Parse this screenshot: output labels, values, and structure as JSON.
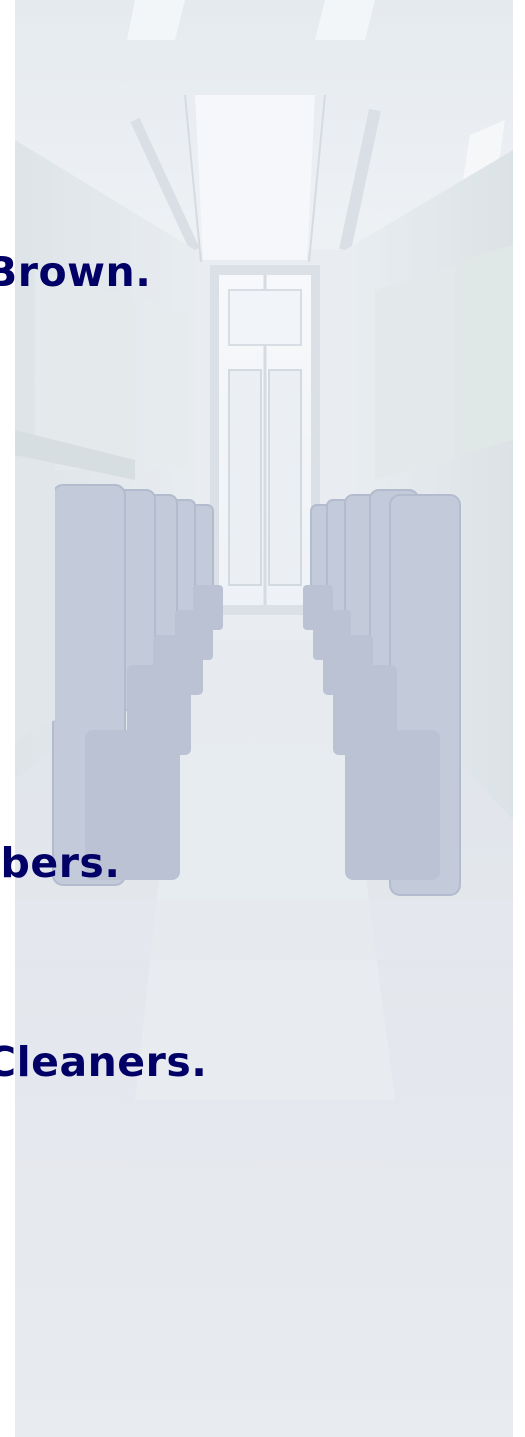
{
  "slide": {
    "lines": [
      "Brown.",
      "ibers.",
      "Cleaners."
    ],
    "text_color": "#000066"
  },
  "background": {
    "icon": "salon-interior-image",
    "palette": {
      "wall": "#e3e7ec",
      "chair": "#9da8c2",
      "floor": "#dfe3e8"
    }
  }
}
